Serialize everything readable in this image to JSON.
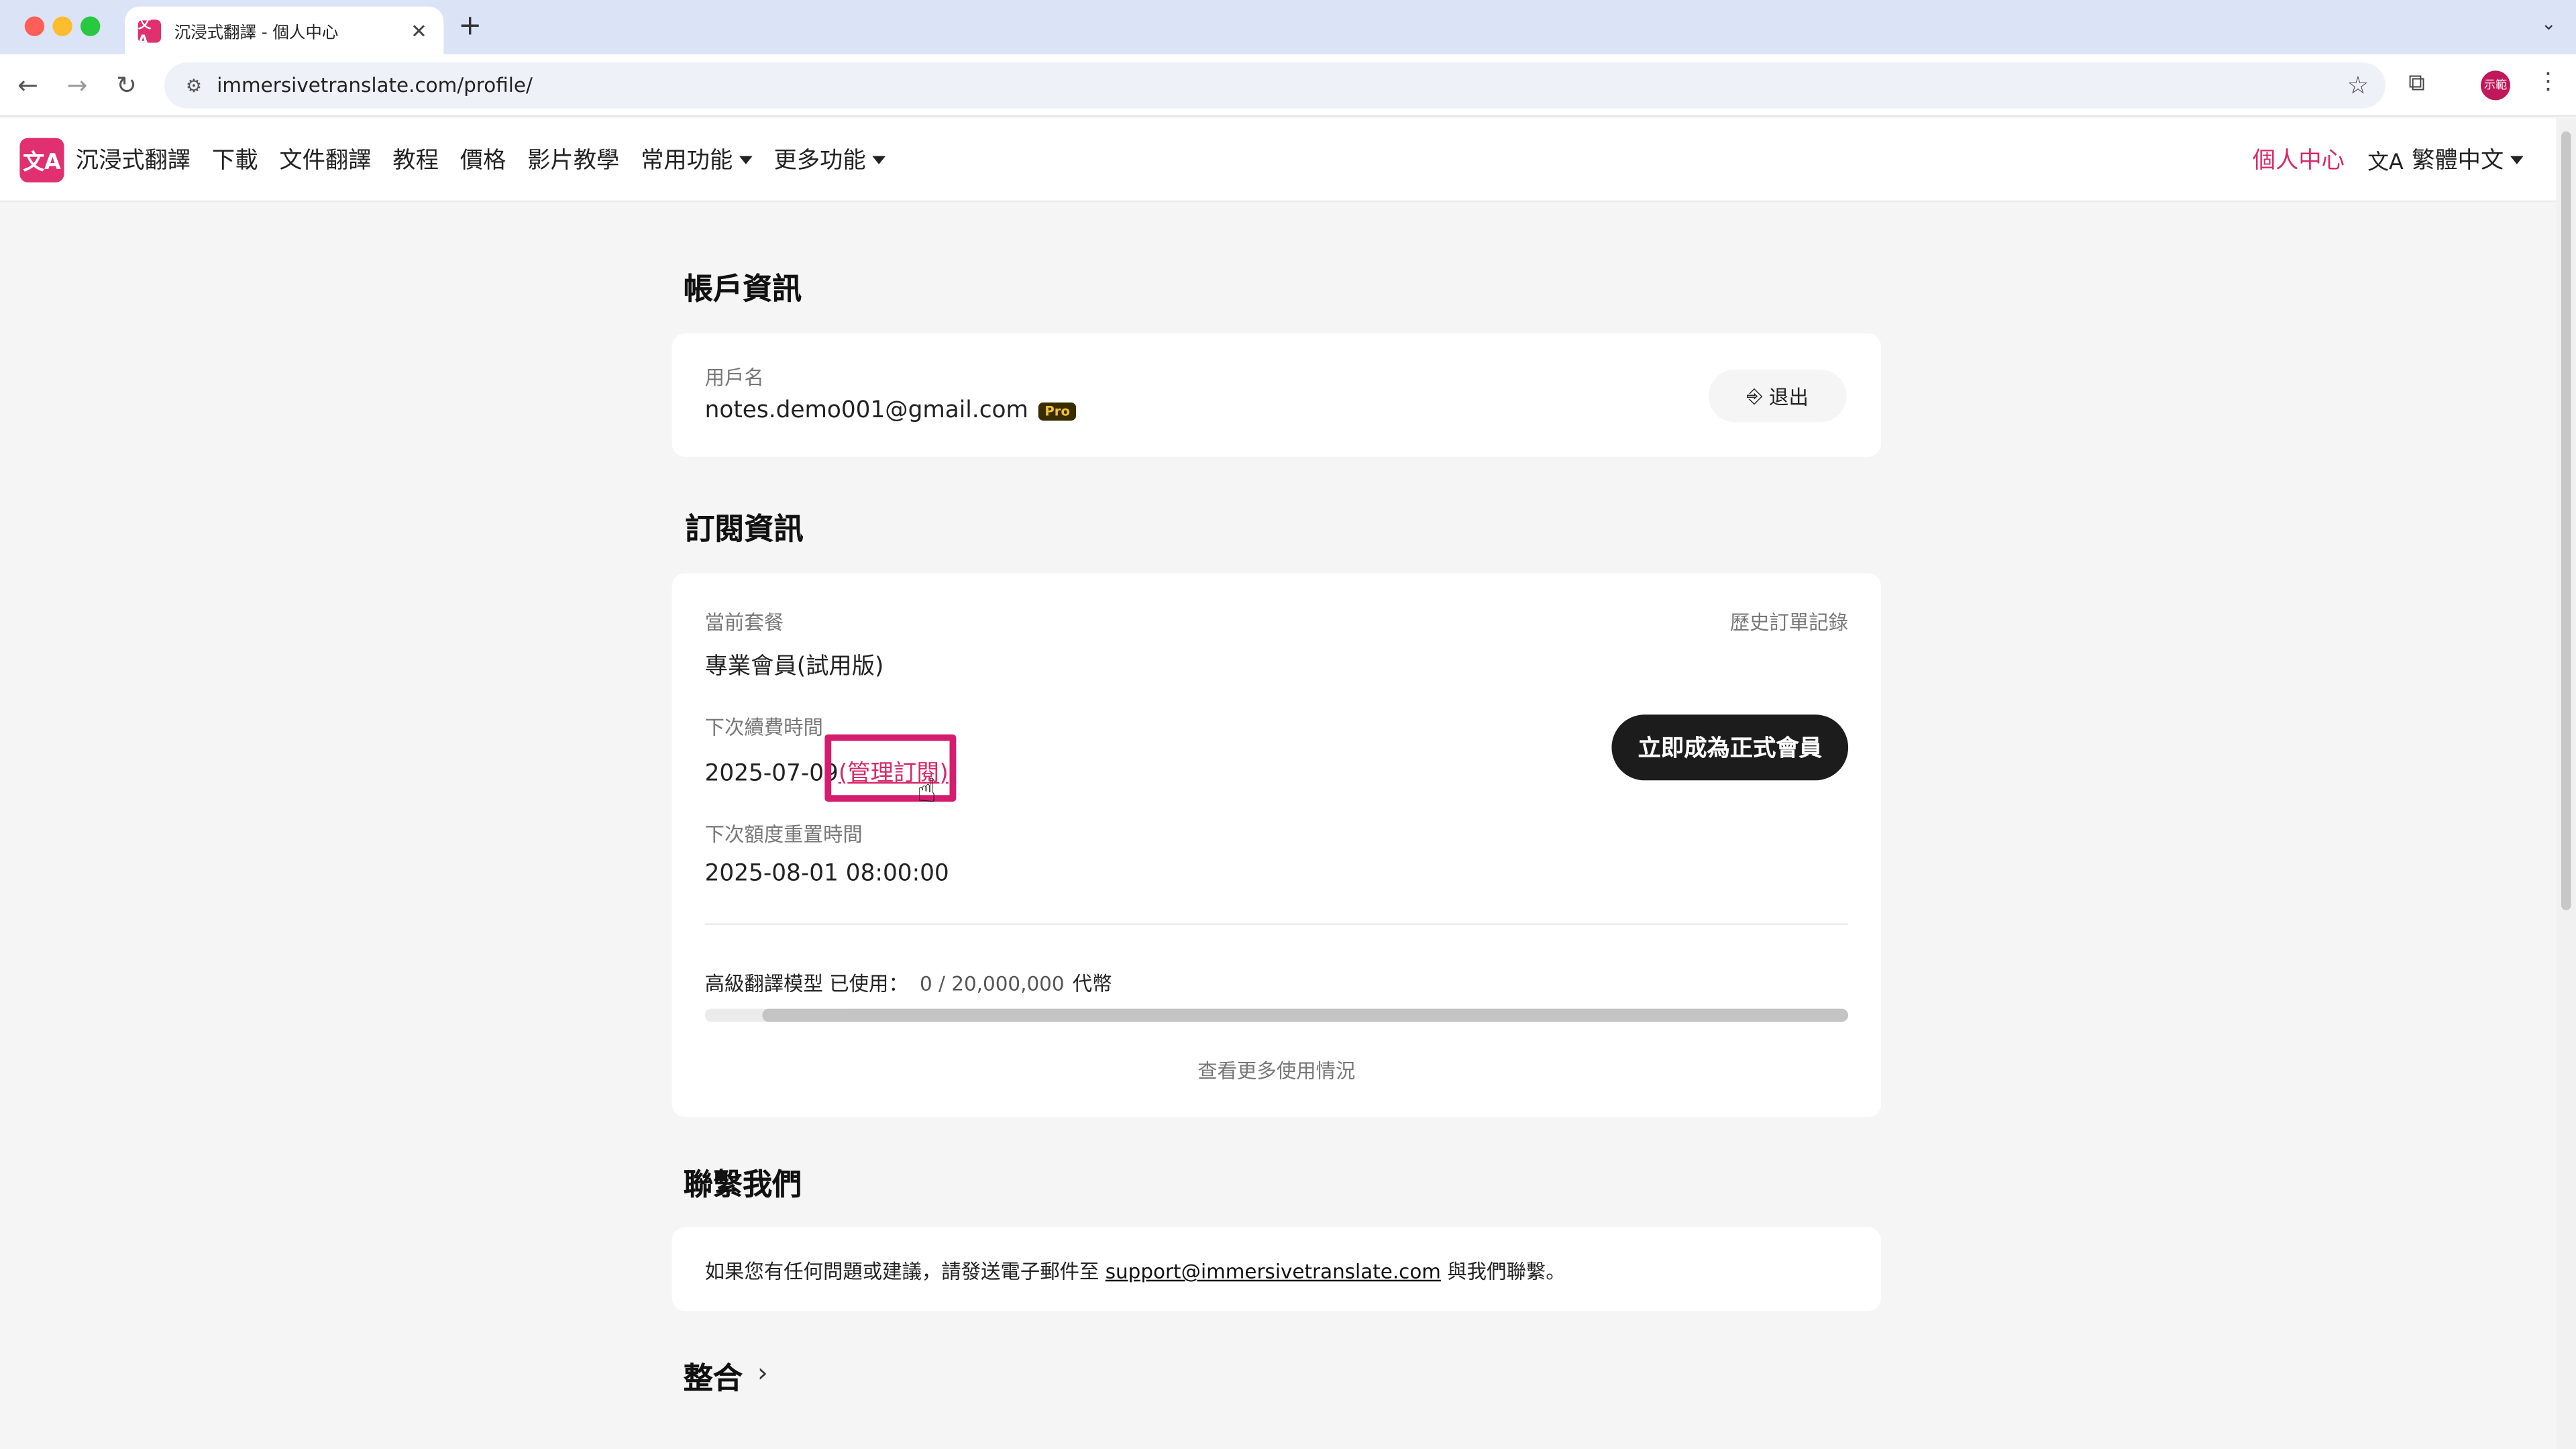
{
  "browser": {
    "tab_title": "沉浸式翻譯 - 個人中心",
    "favicon_text": "文A",
    "url": "immersivetranslate.com/profile/",
    "avatar_text": "示範"
  },
  "header": {
    "logo_text": "文A",
    "brand": "沉浸式翻譯",
    "nav": [
      "下載",
      "文件翻譯",
      "教程",
      "價格",
      "影片教學"
    ],
    "dropdown_common": "常用功能",
    "dropdown_more": "更多功能",
    "profile_link": "個人中心",
    "language": "繁體中文"
  },
  "account": {
    "section_title": "帳戶資訊",
    "username_label": "用戶名",
    "username": "notes.demo001@gmail.com",
    "badge": "Pro",
    "logout": "退出"
  },
  "subscription": {
    "section_title": "訂閱資訊",
    "plan_label": "當前套餐",
    "plan": "專業會員(試用版)",
    "history_link": "歷史訂單記錄",
    "renew_label": "下次續費時間",
    "renew_date": "2025-07-09",
    "manage_open": "(",
    "manage_link": "管理訂閱",
    "manage_close": ")",
    "reset_label": "下次額度重置時間",
    "reset_time": "2025-08-01 08:00:00",
    "upgrade_button": "立即成為正式會員",
    "usage_label": "高級翻譯模型 已使用：",
    "usage_value": "0 / 20,000,000",
    "usage_unit": "代幣",
    "usage_fraction": 0,
    "more_usage": "查看更多使用情況"
  },
  "contact": {
    "section_title": "聯繫我們",
    "text_before": "如果您有任何問題或建議，請發送電子郵件至 ",
    "email": "support@immersivetranslate.com",
    "text_after": " 與我們聯繫。"
  },
  "integration": {
    "section_title": "整合"
  }
}
